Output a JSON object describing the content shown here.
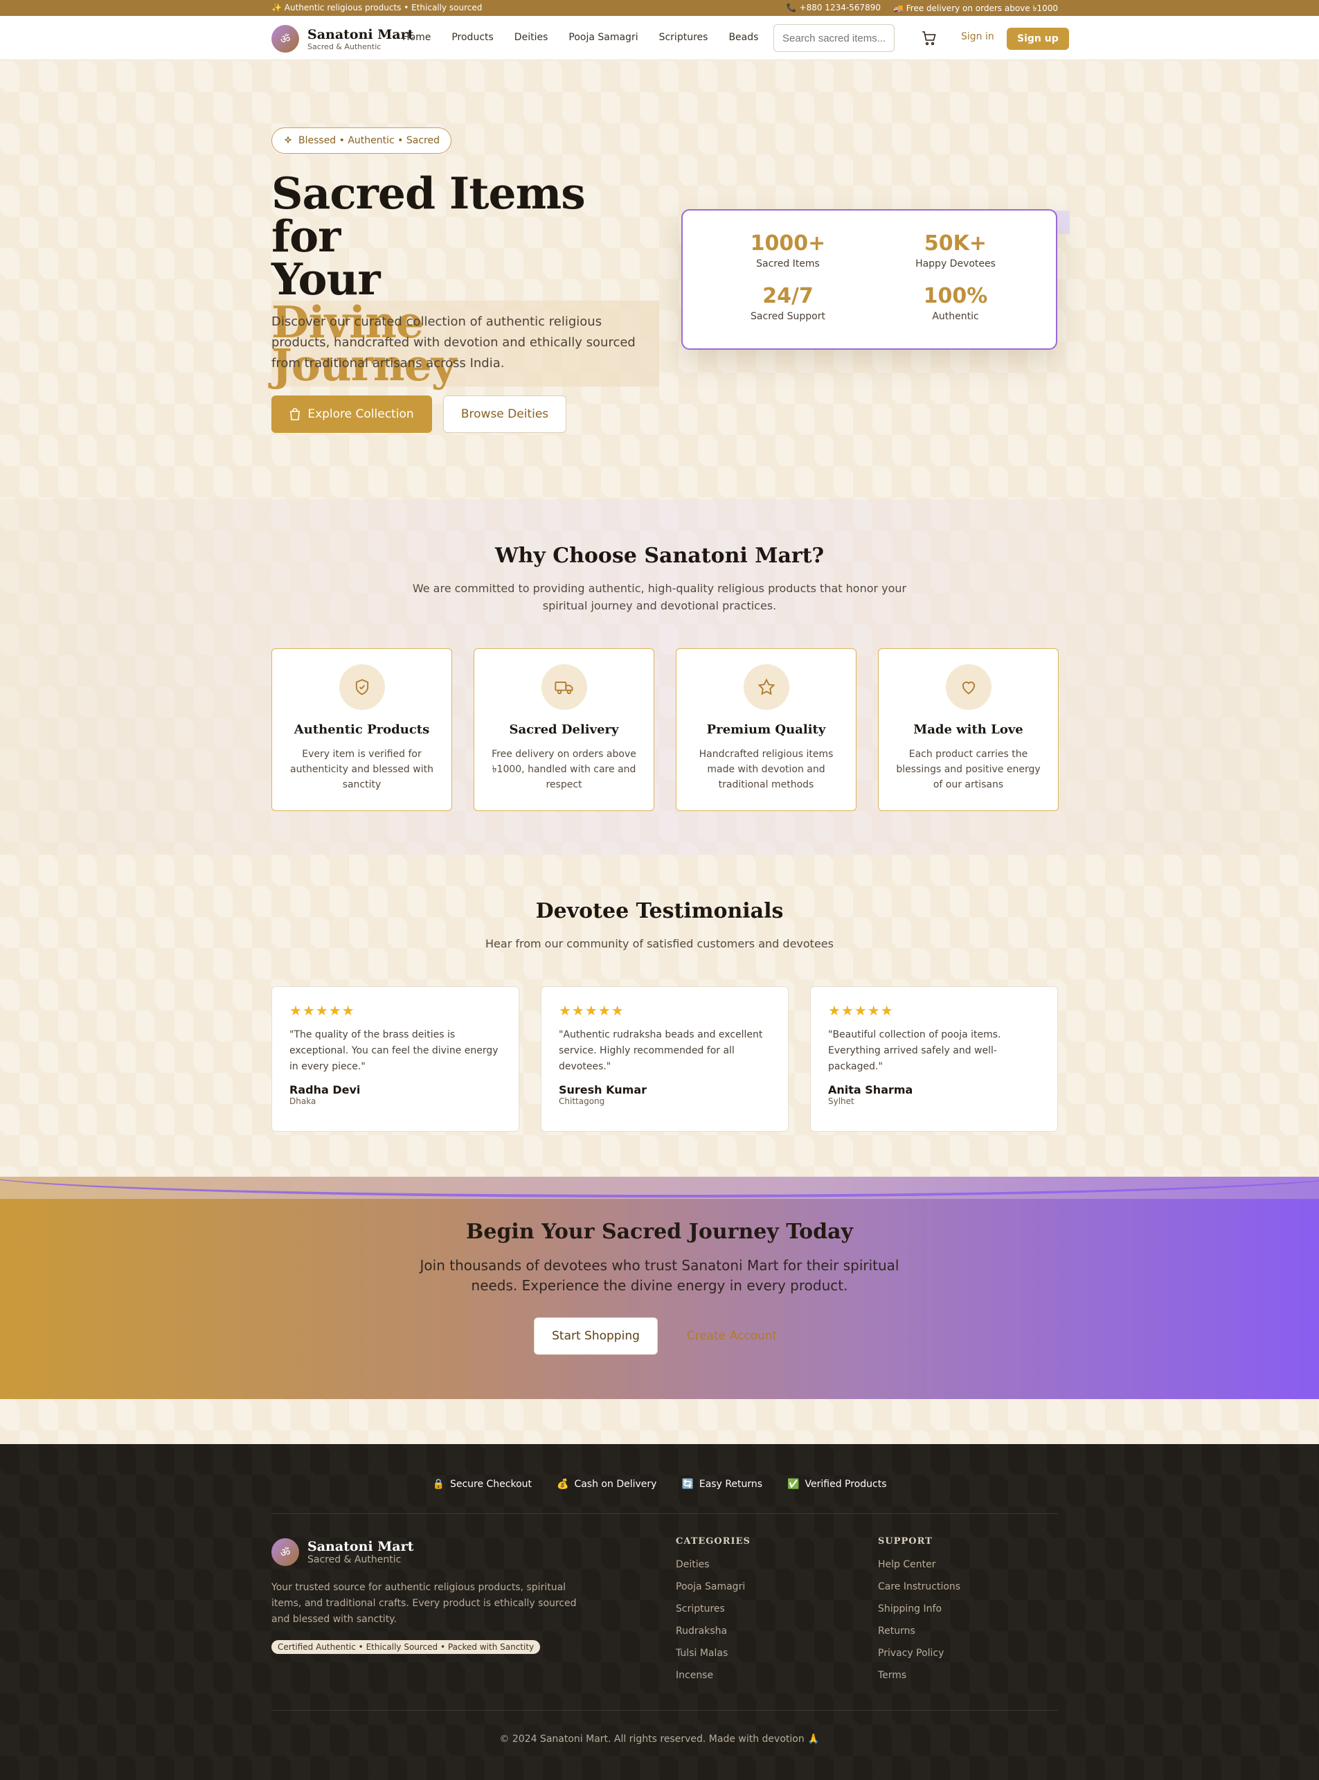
{
  "topbar": {
    "left": "✨ Authentic religious products • Ethically sourced",
    "phone": "📞 +880 1234-567890",
    "delivery": "🚚 Free delivery on orders above ৳1000"
  },
  "brand": {
    "name": "Sanatoni Mart",
    "tagline": "Sacred & Authentic",
    "logo_glyph": "ॐ"
  },
  "nav": {
    "links": [
      "Home",
      "Products",
      "Deities",
      "Pooja Samagri",
      "Scriptures",
      "Beads"
    ],
    "search_placeholder": "Search sacred items...",
    "signin": "Sign in",
    "signup": "Sign up"
  },
  "hero": {
    "badge": "Blessed • Authentic • Sacred",
    "title_line1": "Sacred Items for",
    "title_line2": "Your",
    "title_line3": "Divine Journey",
    "description": "Discover our curated collection of authentic religious products, handcrafted with devotion and ethically sourced from traditional artisans across India.",
    "btn_explore": "Explore Collection",
    "btn_browse": "Browse Deities",
    "stats": [
      {
        "value": "1000+",
        "label": "Sacred Items"
      },
      {
        "value": "50K+",
        "label": "Happy Devotees"
      },
      {
        "value": "24/7",
        "label": "Sacred Support"
      },
      {
        "value": "100%",
        "label": "Authentic"
      }
    ]
  },
  "why": {
    "title": "Why Choose Sanatoni Mart?",
    "subtitle_line1": "We are committed to providing authentic, high-quality religious products that honor your",
    "subtitle_line2": "spiritual journey and devotional practices.",
    "features": [
      {
        "icon": "shield-check-icon",
        "title": "Authentic Products",
        "desc": "Every item is verified for authenticity and blessed with sanctity"
      },
      {
        "icon": "truck-icon",
        "title": "Sacred Delivery",
        "desc": "Free delivery on orders above ৳1000, handled with care and respect"
      },
      {
        "icon": "star-icon",
        "title": "Premium Quality",
        "desc": "Handcrafted religious items made with devotion and traditional methods"
      },
      {
        "icon": "heart-icon",
        "title": "Made with Love",
        "desc": "Each product carries the blessings and positive energy of our artisans"
      }
    ]
  },
  "testimonials": {
    "title": "Devotee Testimonials",
    "subtitle": "Hear from our community of satisfied customers and devotees",
    "items": [
      {
        "stars": "★★★★★",
        "quote": "\"The quality of the brass deities is exceptional. You can feel the divine energy in every piece.\"",
        "name": "Radha Devi",
        "location": "Dhaka"
      },
      {
        "stars": "★★★★★",
        "quote": "\"Authentic rudraksha beads and excellent service. Highly recommended for all devotees.\"",
        "name": "Suresh Kumar",
        "location": "Chittagong"
      },
      {
        "stars": "★★★★★",
        "quote": "\"Beautiful collection of pooja items. Everything arrived safely and well-packaged.\"",
        "name": "Anita Sharma",
        "location": "Sylhet"
      }
    ]
  },
  "cta": {
    "title": "Begin Your Sacred Journey Today",
    "line1": "Join thousands of devotees who trust Sanatoni Mart for their spiritual",
    "line2": "needs. Experience the divine energy in every product.",
    "btn_start": "Start Shopping",
    "btn_create": "Create Account"
  },
  "footer": {
    "trust": [
      {
        "icon": "🔒",
        "label": "Secure Checkout"
      },
      {
        "icon": "💰",
        "label": "Cash on Delivery"
      },
      {
        "icon": "🔄",
        "label": "Easy Returns"
      },
      {
        "icon": "✅",
        "label": "Verified Products"
      }
    ],
    "description": "Your trusted source for authentic religious products, spiritual items, and traditional crafts. Every product is ethically sourced and blessed with sanctity.",
    "badge": "Certified Authentic • Ethically Sourced • Packed with Sanctity",
    "categories_title": "CATEGORIES",
    "categories": [
      "Deities",
      "Pooja Samagri",
      "Scriptures",
      "Rudraksha",
      "Tulsi Malas",
      "Incense"
    ],
    "support_title": "SUPPORT",
    "support": [
      "Help Center",
      "Care Instructions",
      "Shipping Info",
      "Returns",
      "Privacy Policy",
      "Terms"
    ],
    "copyright": "© 2024 Sanatoni Mart. All rights reserved. Made with devotion 🙏"
  },
  "colors": {
    "gold": "#c99a3b",
    "brown": "#a47a39",
    "purple": "#8a5ef0",
    "footer_bg": "#211d18"
  }
}
